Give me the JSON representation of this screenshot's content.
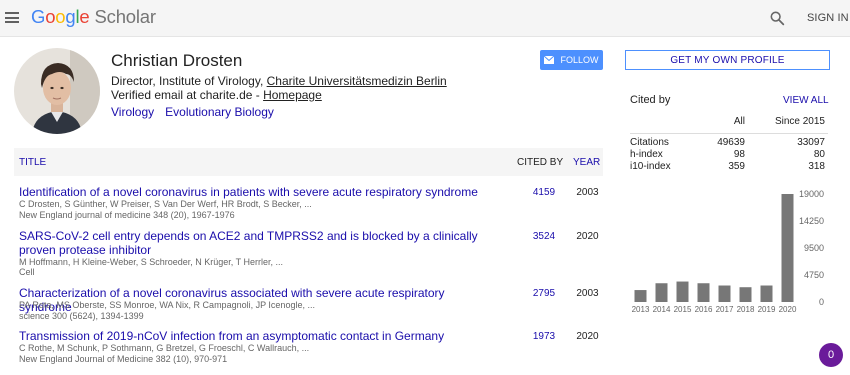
{
  "header": {
    "logo": [
      "G",
      "o",
      "o",
      "g",
      "l",
      "e"
    ],
    "logo_suffix": "Scholar",
    "signin_label": "SIGN IN"
  },
  "profile": {
    "name": "Christian Drosten",
    "affiliation_prefix": "Director, Institute of Virology, ",
    "affiliation_link": "Charite Universitätsmedizin Berlin",
    "verified_prefix": "Verified email at charite.de - ",
    "homepage_link": "Homepage",
    "interests": [
      "Virology",
      "Evolutionary Biology"
    ],
    "follow_label": "FOLLOW"
  },
  "table": {
    "col_title": "TITLE",
    "col_cited": "CITED BY",
    "col_year": "YEAR",
    "rows": [
      {
        "title": "Identification of a novel coronavirus in patients with severe acute respiratory syndrome",
        "authors": "C Drosten, S Günther, W Preiser, S Van Der Werf, HR Brodt, S Becker, ...",
        "venue": "New England journal of medicine 348 (20), 1967-1976",
        "cited": "4159",
        "year": "2003"
      },
      {
        "title": "SARS-CoV-2 cell entry depends on ACE2 and TMPRSS2 and is blocked by a clinically proven protease inhibitor",
        "authors": "M Hoffmann, H Kleine-Weber, S Schroeder, N Krüger, T Herrler, ...",
        "venue": "Cell",
        "cited": "3524",
        "year": "2020"
      },
      {
        "title": "Characterization of a novel coronavirus associated with severe acute respiratory syndrome",
        "authors": "PA Rota, MS Oberste, SS Monroe, WA Nix, R Campagnoli, JP Icenogle, ...",
        "venue": "science 300 (5624), 1394-1399",
        "cited": "2795",
        "year": "2003"
      },
      {
        "title": "Transmission of 2019-nCoV infection from an asymptomatic contact in Germany",
        "authors": "C Rothe, M Schunk, P Sothmann, G Bretzel, G Froeschl, C Wallrauch, ...",
        "venue": "New England Journal of Medicine 382 (10), 970-971",
        "cited": "1973",
        "year": "2020"
      }
    ]
  },
  "sidebar": {
    "get_profile_label": "GET MY OWN PROFILE",
    "cited_by_label": "Cited by",
    "view_all_label": "VIEW ALL",
    "col_all": "All",
    "col_since": "Since 2015",
    "stats": [
      {
        "label": "Citations",
        "all": "49639",
        "since": "33097"
      },
      {
        "label": "h-index",
        "all": "98",
        "since": "80"
      },
      {
        "label": "i10-index",
        "all": "359",
        "since": "318"
      }
    ]
  },
  "chart_data": {
    "type": "bar",
    "categories": [
      "2013",
      "2014",
      "2015",
      "2016",
      "2017",
      "2018",
      "2019",
      "2020"
    ],
    "values": [
      2100,
      3300,
      3600,
      3300,
      2900,
      2600,
      2900,
      19000
    ],
    "yticks": [
      "19000",
      "14250",
      "9500",
      "4750",
      "0"
    ],
    "ylim": [
      0,
      19000
    ],
    "bar_color": "#777777"
  },
  "notification_count": "0"
}
